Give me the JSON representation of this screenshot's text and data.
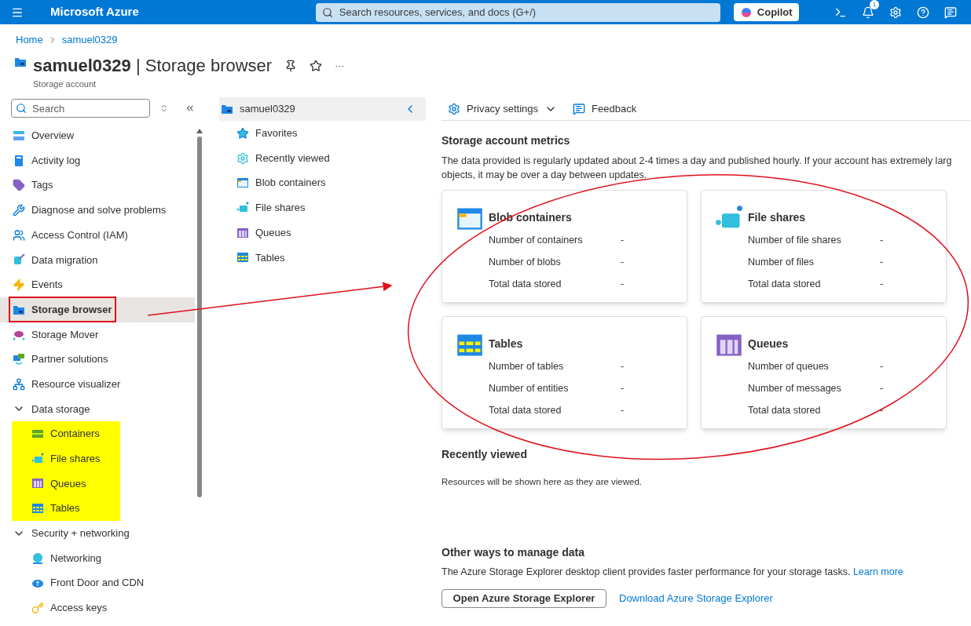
{
  "topbar": {
    "brand": "Microsoft Azure",
    "search_placeholder": "Search resources, services, and docs (G+/)",
    "copilot": "Copilot",
    "notification_count": "1"
  },
  "breadcrumb": [
    "Home",
    "samuel0329"
  ],
  "header": {
    "resource": "samuel0329",
    "separator": "|",
    "page": "Storage browser",
    "subtitle": "Storage account",
    "more": "···"
  },
  "sidebar": {
    "search_placeholder": "Search",
    "items": [
      {
        "label": "Overview",
        "kind": "overview",
        "selected": false,
        "outlined": false
      },
      {
        "label": "Activity log",
        "kind": "log",
        "selected": false,
        "outlined": false
      },
      {
        "label": "Tags",
        "kind": "tag",
        "selected": false,
        "outlined": false
      },
      {
        "label": "Diagnose and solve problems",
        "kind": "tools",
        "selected": false,
        "outlined": false
      },
      {
        "label": "Access Control (IAM)",
        "kind": "people",
        "selected": false,
        "outlined": false
      },
      {
        "label": "Data migration",
        "kind": "migration",
        "selected": false,
        "outlined": false
      },
      {
        "label": "Events",
        "kind": "bolt",
        "selected": false,
        "outlined": false
      },
      {
        "label": "Storage browser",
        "kind": "folder",
        "selected": true,
        "outlined": true
      },
      {
        "label": "Storage Mover",
        "kind": "cloud",
        "selected": false,
        "outlined": false
      },
      {
        "label": "Partner solutions",
        "kind": "partner",
        "selected": false,
        "outlined": false
      },
      {
        "label": "Resource visualizer",
        "kind": "tree",
        "selected": false,
        "outlined": false
      }
    ],
    "groups": [
      {
        "label": "Data storage",
        "expanded": true,
        "highlighted": true,
        "children": [
          {
            "label": "Containers",
            "kind": "containers"
          },
          {
            "label": "File shares",
            "kind": "fileshare"
          },
          {
            "label": "Queues",
            "kind": "queue"
          },
          {
            "label": "Tables",
            "kind": "table"
          }
        ]
      },
      {
        "label": "Security + networking",
        "expanded": true,
        "highlighted": false,
        "children": [
          {
            "label": "Networking",
            "kind": "network"
          },
          {
            "label": "Front Door and CDN",
            "kind": "cloudup"
          },
          {
            "label": "Access keys",
            "kind": "key"
          }
        ]
      }
    ]
  },
  "tree": {
    "root": "samuel0329",
    "items": [
      {
        "label": "Favorites",
        "kind": "star"
      },
      {
        "label": "Recently viewed",
        "kind": "gear"
      },
      {
        "label": "Blob containers",
        "kind": "blob"
      },
      {
        "label": "File shares",
        "kind": "fileshare"
      },
      {
        "label": "Queues",
        "kind": "queue"
      },
      {
        "label": "Tables",
        "kind": "table"
      }
    ]
  },
  "toolbar": [
    "Privacy settings",
    "Feedback"
  ],
  "metrics": {
    "title": "Storage account metrics",
    "description": "The data provided is regularly updated about 2-4 times a day and published hourly. If your account has extremely larg objects, it may be over a day between updates.",
    "cards": [
      {
        "title": "Blob containers",
        "kind": "blob",
        "rows": [
          {
            "label": "Number of containers",
            "value": "-"
          },
          {
            "label": "Number of blobs",
            "value": "-"
          },
          {
            "label": "Total data stored",
            "value": "-"
          }
        ]
      },
      {
        "title": "File shares",
        "kind": "fileshare",
        "rows": [
          {
            "label": "Number of file shares",
            "value": "-"
          },
          {
            "label": "Number of files",
            "value": "-"
          },
          {
            "label": "Total data stored",
            "value": "-"
          }
        ]
      },
      {
        "title": "Tables",
        "kind": "table",
        "rows": [
          {
            "label": "Number of tables",
            "value": "-"
          },
          {
            "label": "Number of entities",
            "value": "-"
          },
          {
            "label": "Total data stored",
            "value": "-"
          }
        ]
      },
      {
        "title": "Queues",
        "kind": "queue",
        "rows": [
          {
            "label": "Number of queues",
            "value": "-"
          },
          {
            "label": "Number of messages",
            "value": "-"
          },
          {
            "label": "Total data stored",
            "value": "-"
          }
        ]
      }
    ]
  },
  "recent": {
    "title": "Recently viewed",
    "text": "Resources will be shown here as they are viewed."
  },
  "other": {
    "title": "Other ways to manage data",
    "text": "The Azure Storage Explorer desktop client provides faster performance for your storage tasks.",
    "link": "Learn more",
    "button": "Open Azure Storage Explorer",
    "download": "Download Azure Storage Explorer"
  }
}
